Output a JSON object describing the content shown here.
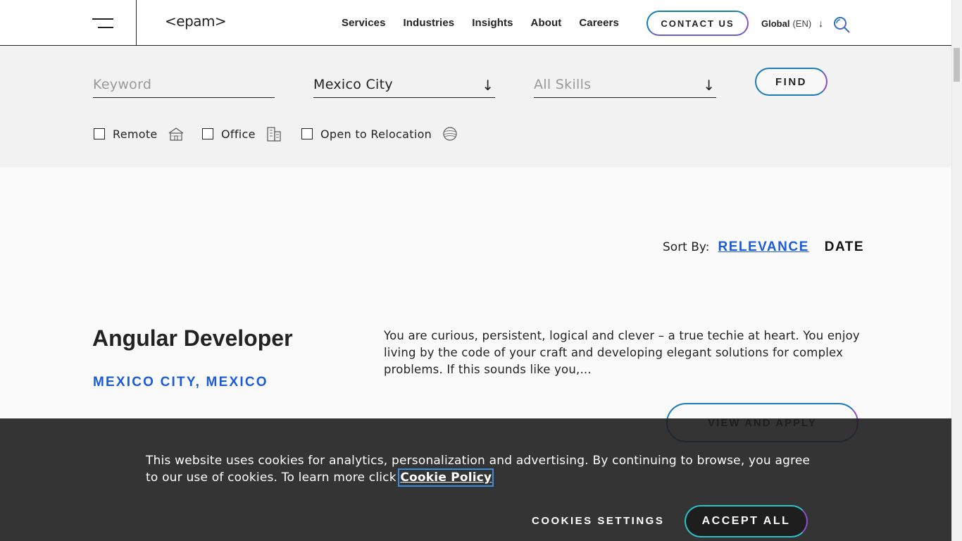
{
  "header": {
    "logo": "<epam>",
    "nav": [
      "Services",
      "Industries",
      "Insights",
      "About",
      "Careers"
    ],
    "contact_label": "CONTACT US",
    "region": "Global",
    "language": "(EN)"
  },
  "search": {
    "keyword_placeholder": "Keyword",
    "location_value": "Mexico City",
    "skills_placeholder": "All Skills",
    "find_label": "FIND",
    "filters": [
      {
        "label": "Remote",
        "icon": "home-icon",
        "checked": false
      },
      {
        "label": "Office",
        "icon": "building-icon",
        "checked": false
      },
      {
        "label": "Open to Relocation",
        "icon": "globe-icon",
        "checked": false
      }
    ]
  },
  "sort": {
    "label": "Sort By:",
    "relevance": "RELEVANCE",
    "date": "DATE"
  },
  "job": {
    "title": "Angular Developer",
    "location": "MEXICO CITY, MEXICO",
    "description": "You are curious, persistent, logical and clever – a true techie at heart. You enjoy living by the code of your craft and developing elegant solutions for complex problems. If this sounds like you,...",
    "cta": "VIEW AND APPLY"
  },
  "cookie": {
    "text": "This website uses cookies for analytics, personalization and advertising. By continuing to browse, you agree to our use of cookies. To learn more click ",
    "link": "Cookie Policy",
    "settings": "COOKIES SETTINGS",
    "accept": "ACCEPT ALL"
  },
  "colors": {
    "accent_blue": "#1a5bdc",
    "gradient_start": "#1a7bb5",
    "gradient_end": "#8a4fc8",
    "cookie_bg": "#1e1e1e"
  }
}
